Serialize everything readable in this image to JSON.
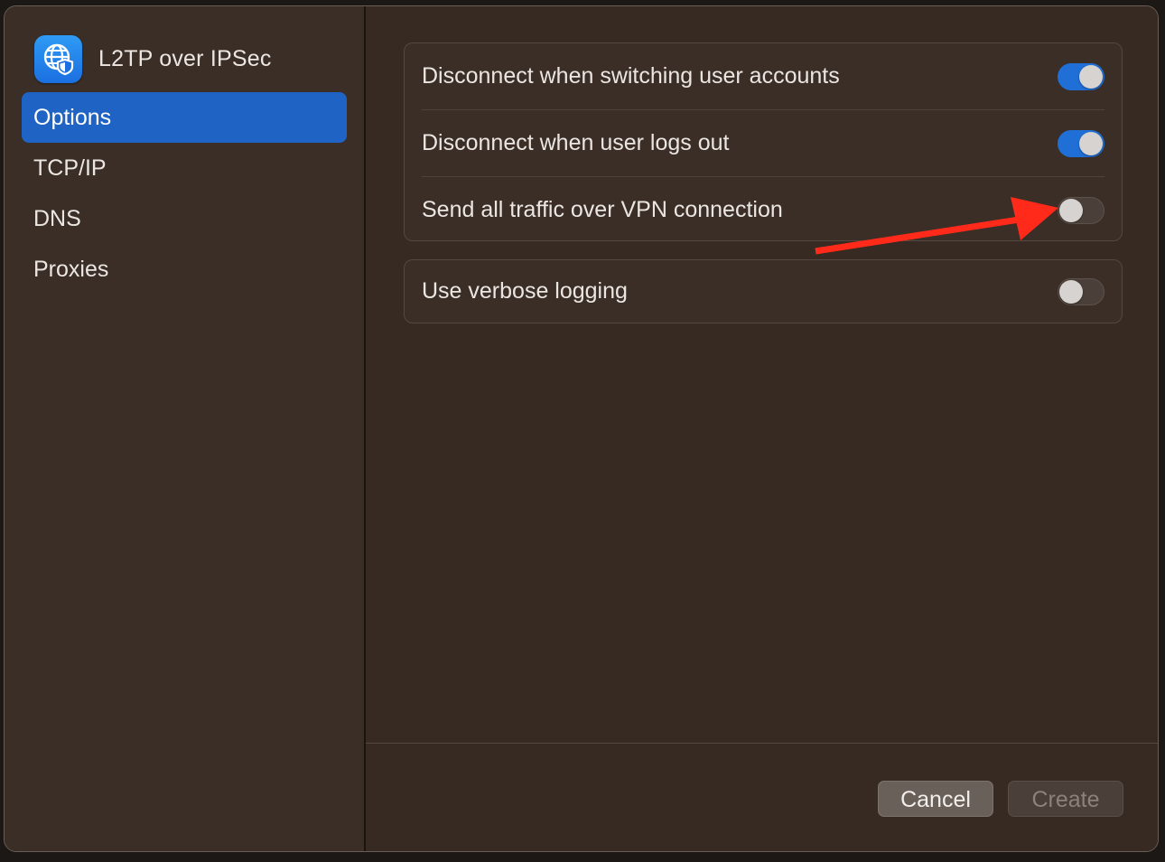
{
  "sidebar": {
    "title": "L2TP over IPSec",
    "icon": "globe-shield-icon",
    "items": [
      {
        "label": "Options",
        "active": true
      },
      {
        "label": "TCP/IP",
        "active": false
      },
      {
        "label": "DNS",
        "active": false
      },
      {
        "label": "Proxies",
        "active": false
      }
    ]
  },
  "options": {
    "group1": [
      {
        "label": "Disconnect when switching user accounts",
        "enabled": true
      },
      {
        "label": "Disconnect when user logs out",
        "enabled": true
      },
      {
        "label": "Send all traffic over VPN connection",
        "enabled": false
      }
    ],
    "group2": [
      {
        "label": "Use verbose logging",
        "enabled": false
      }
    ]
  },
  "footer": {
    "cancel_label": "Cancel",
    "create_label": "Create"
  },
  "colors": {
    "accent": "#1f63c4",
    "toggle_on": "#1f6fd6",
    "annotation_arrow": "#ff2a1a"
  }
}
